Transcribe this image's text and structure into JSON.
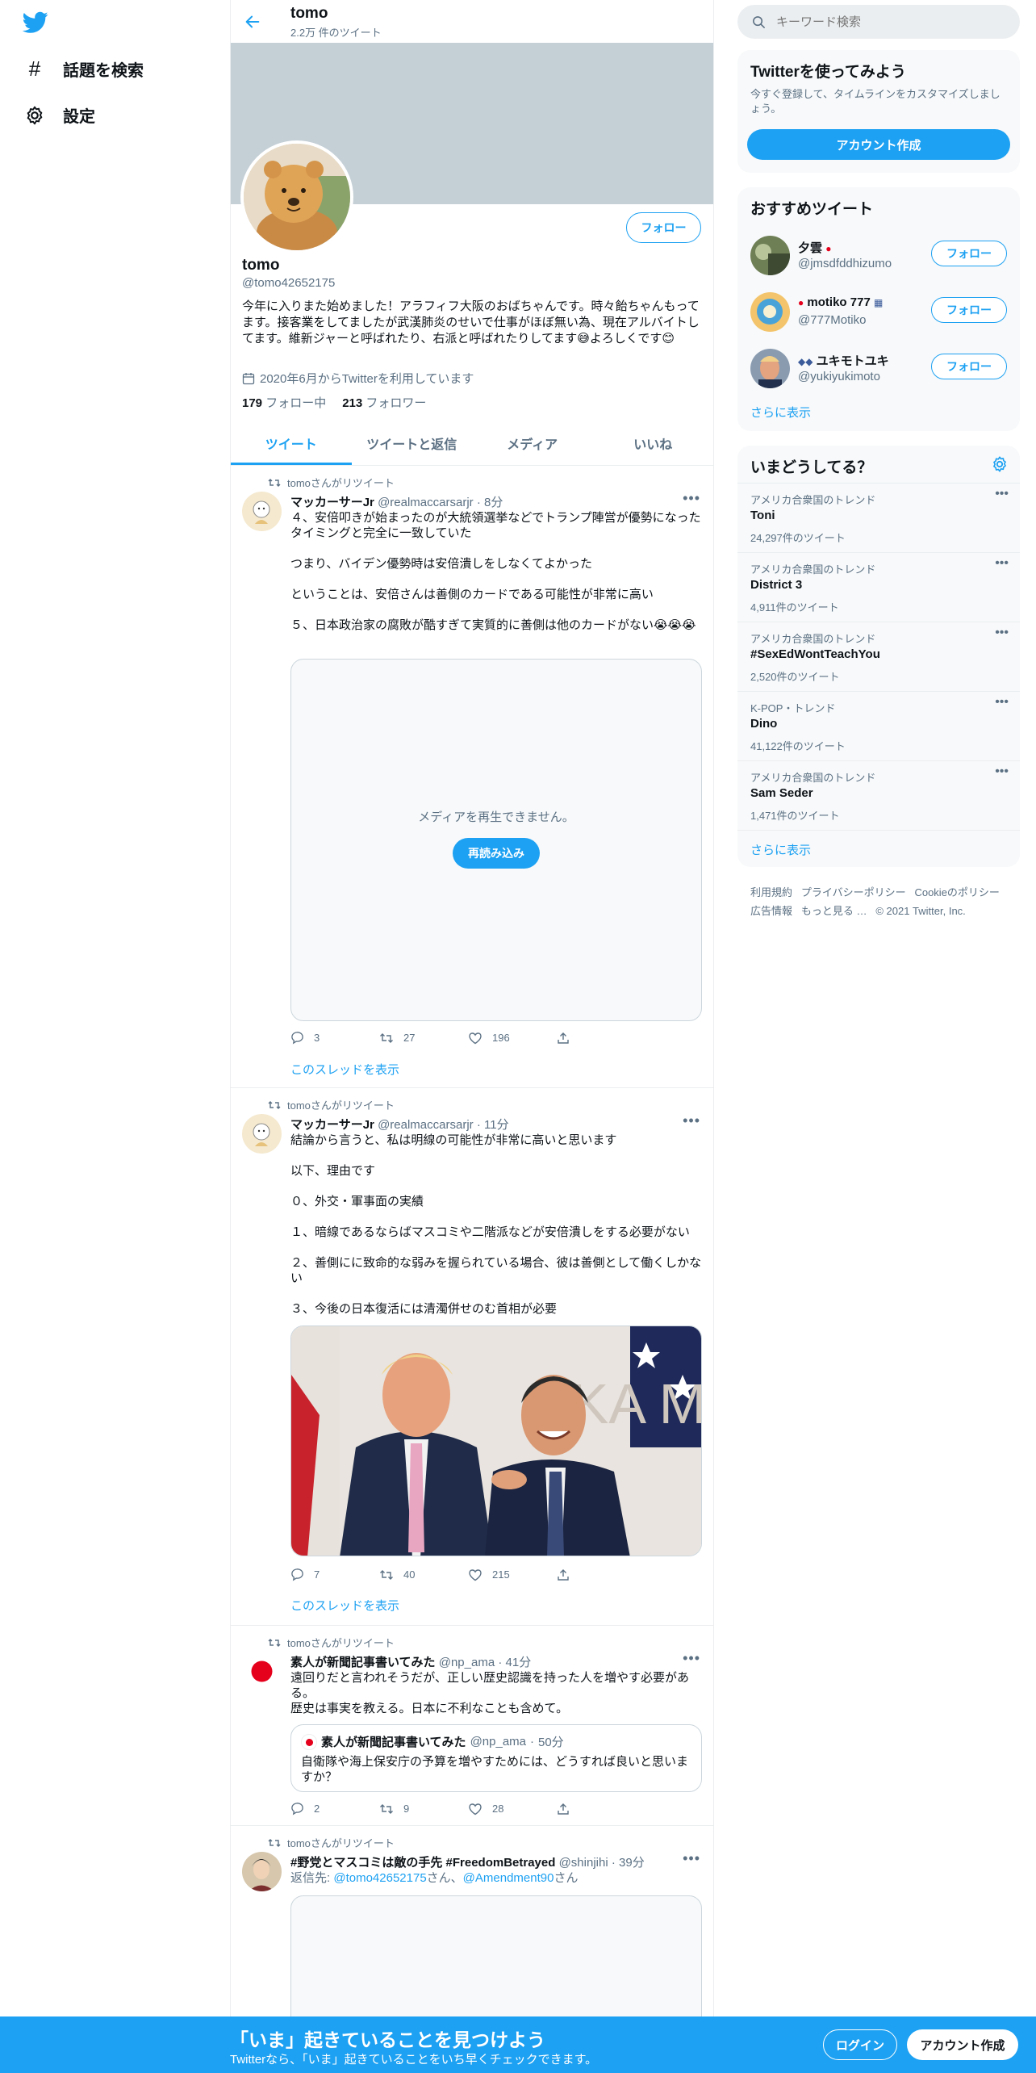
{
  "nav": {
    "explore_label": "話題を検索",
    "settings_label": "設定"
  },
  "header": {
    "title": "tomo",
    "tweet_count": "2.2万 件のツイート"
  },
  "profile": {
    "name": "tomo",
    "handle": "@tomo42652175",
    "bio": "今年に入りまた始めました！アラフィフ大阪のおばちゃんです。時々飴ちゃんもってます。接客業をしてましたが武漢肺炎のせいで仕事がほぼ無い為、現在アルバイトしてます。維新ジャーと呼ばれたり、右派と呼ばれたりしてます😅よろしくです😊",
    "joined": "2020年6月からTwitterを利用しています",
    "following_count": "179",
    "following_label": "フォロー中",
    "followers_count": "213",
    "followers_label": "フォロワー",
    "follow_label": "フォロー"
  },
  "tabs": [
    "ツイート",
    "ツイートと返信",
    "メディア",
    "いいね"
  ],
  "tweets": [
    {
      "retweet_label": "tomoさんがリツイート",
      "name": "マッカーサーJr",
      "handle": "@realmaccarsarjr",
      "time": "8分",
      "paragraphs": [
        "４、安倍叩きが始まったのが大統領選挙などでトランプ陣営が優勢になったタイミングと完全に一致していた",
        "つまり、バイデン優勢時は安倍潰しをしなくてよかった",
        "ということは、安倍さんは善側のカードである可能性が非常に高い",
        "５、日本政治家の腐敗が酷すぎて実質的に善側は他のカードがない😭😭😭"
      ],
      "media_error": "メディアを再生できません。",
      "reload_label": "再読み込み",
      "replies": "3",
      "retweets": "27",
      "likes": "196",
      "thread_link": "このスレッドを表示"
    },
    {
      "retweet_label": "tomoさんがリツイート",
      "name": "マッカーサーJr",
      "handle": "@realmaccarsarjr",
      "time": "11分",
      "paragraphs": [
        "結論から言うと、私は明線の可能性が非常に高いと思います",
        "以下、理由です",
        "０、外交・軍事面の実績",
        "１、暗線であるならばマスコミや二階派などが安倍潰しをする必要がない",
        "２、善側にに致命的な弱みを握られている場合、彼は善側として働くしかない",
        "３、今後の日本復活には清濁併せのむ首相が必要"
      ],
      "replies": "7",
      "retweets": "40",
      "likes": "215",
      "thread_link": "このスレッドを表示"
    },
    {
      "retweet_label": "tomoさんがリツイート",
      "name": "素人が新聞記事書いてみた",
      "handle": "@np_ama",
      "time": "41分",
      "text": "遠回りだと言われそうだが、正しい歴史認識を持った人を増やす必要がある。\n歴史は事実を教える。日本に不利なことも含めて。",
      "quote": {
        "name": "素人が新聞記事書いてみた",
        "handle": "@np_ama",
        "time": "50分",
        "text": "自衛隊や海上保安庁の予算を増やすためには、どうすれば良いと思いますか？"
      },
      "replies": "2",
      "retweets": "9",
      "likes": "28"
    },
    {
      "retweet_label": "tomoさんがリツイート",
      "name": "#野党とマスコミは敵の手先 #FreedomBetrayed",
      "handle": "@shinjihi",
      "time": "39分",
      "reply_prefix": "返信先: ",
      "reply_to_1": "@tomo42652175",
      "reply_mid": "さん、",
      "reply_to_2": "@Amendment90",
      "reply_suffix": "さん"
    }
  ],
  "search": {
    "placeholder": "キーワード検索"
  },
  "signup": {
    "title": "Twitterを使ってみよう",
    "text": "今すぐ登録して、タイムラインをカスタマイズしましょう。",
    "button": "アカウント作成"
  },
  "recommended": {
    "title": "おすすめツイート",
    "users": [
      {
        "name": "夕雲",
        "handle": "@jmsdfddhizumo"
      },
      {
        "name": "motiko 777",
        "handle": "@777Motiko"
      },
      {
        "name": "ユキモトユキ",
        "handle": "@yukiyukimoto"
      }
    ],
    "follow_label": "フォロー",
    "show_more": "さらに表示"
  },
  "trends": {
    "title": "いまどうしてる？",
    "items": [
      {
        "category": "アメリカ合衆国のトレンド",
        "name": "Toni",
        "count": "24,297件のツイート"
      },
      {
        "category": "アメリカ合衆国のトレンド",
        "name": "District 3",
        "count": "4,911件のツイート"
      },
      {
        "category": "アメリカ合衆国のトレンド",
        "name": "#SexEdWontTeachYou",
        "count": "2,520件のツイート"
      },
      {
        "category": "K-POP・トレンド",
        "name": "Dino",
        "count": "41,122件のツイート"
      },
      {
        "category": "アメリカ合衆国のトレンド",
        "name": "Sam Seder",
        "count": "1,471件のツイート"
      }
    ],
    "show_more": "さらに表示"
  },
  "footer": {
    "terms": "利用規約",
    "privacy": "プライバシーポリシー",
    "cookie": "Cookieのポリシー",
    "ads": "広告情報",
    "more": "もっと見る …",
    "copyright": "© 2021 Twitter, Inc."
  },
  "bottom_bar": {
    "title": "「いま」起きていることを見つけよう",
    "subtitle": "Twitterなら、「いま」起きていることをいち早くチェックできます。",
    "login": "ログイン",
    "signup": "アカウント作成"
  },
  "colors": {
    "accent": "#1da1f2",
    "banner": "#c4cfd6",
    "muted": "#5b7083"
  }
}
